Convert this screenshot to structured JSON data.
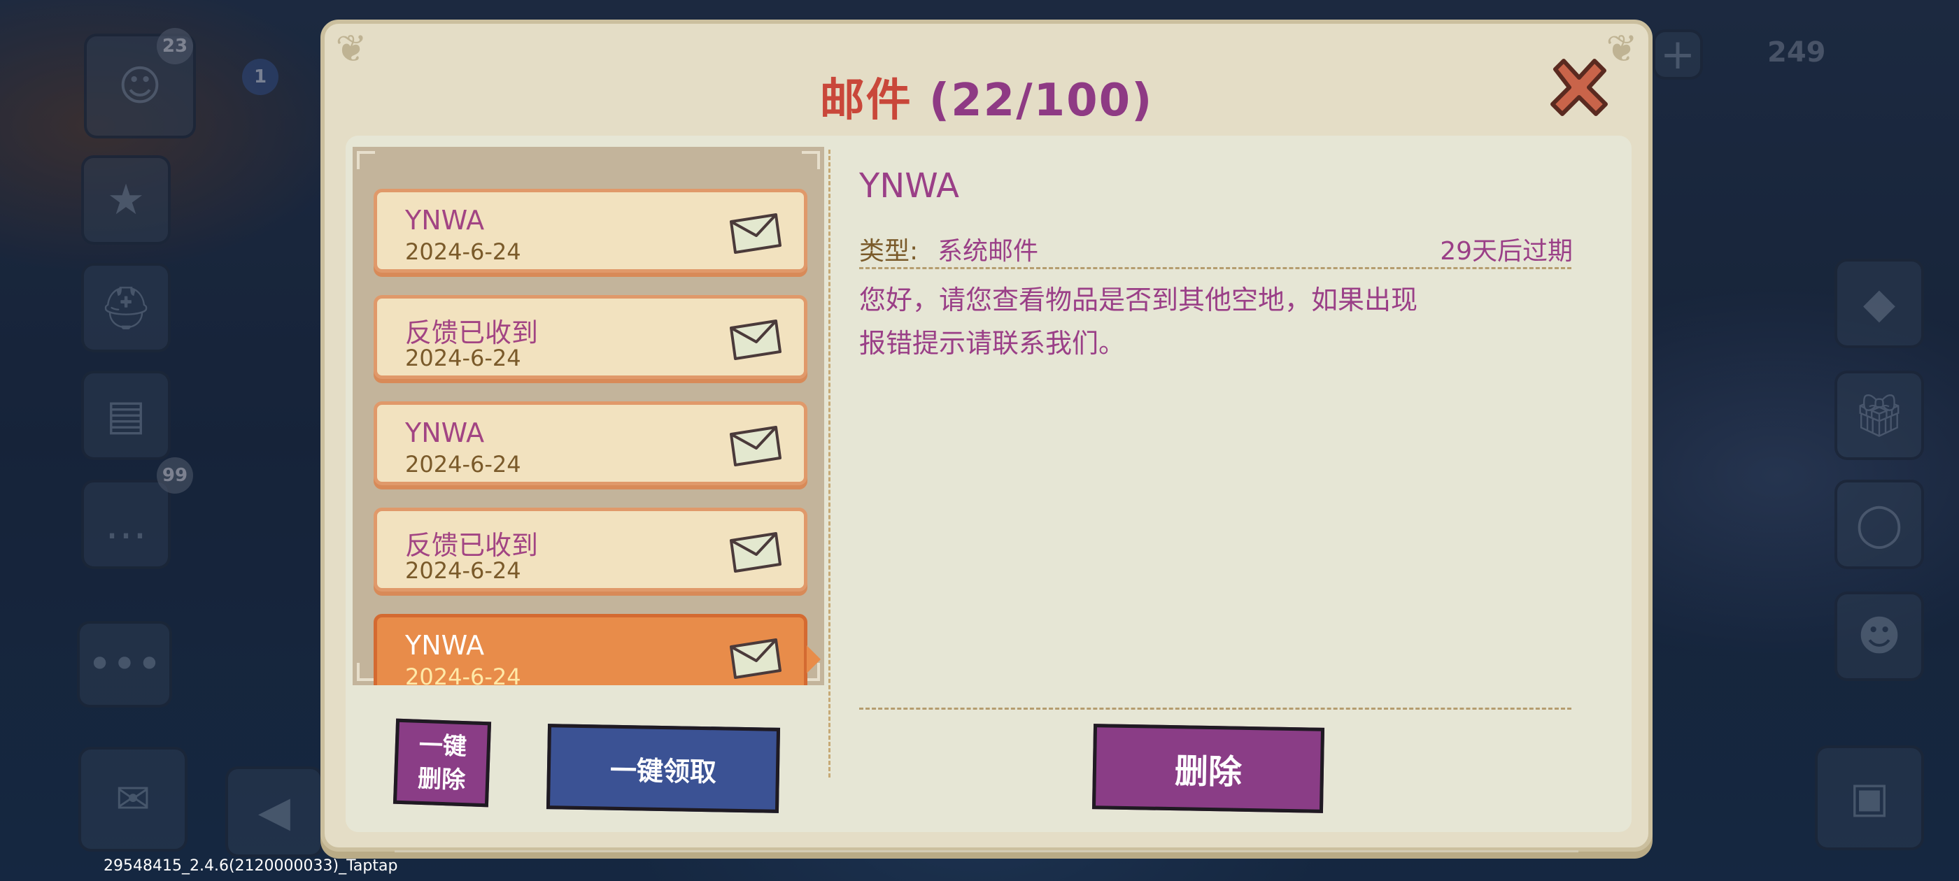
{
  "dialog": {
    "title": "邮件",
    "count": "(22/100)"
  },
  "hud": {
    "avatar_badge": "23",
    "level_badge": "1",
    "chat_badge": "99",
    "currency": "249"
  },
  "mail_list": [
    {
      "name": "YNWA",
      "date": "2024-6-24",
      "selected": false
    },
    {
      "name": "反馈已收到",
      "date": "2024-6-24",
      "selected": false
    },
    {
      "name": "YNWA",
      "date": "2024-6-24",
      "selected": false
    },
    {
      "name": "反馈已收到",
      "date": "2024-6-24",
      "selected": false
    },
    {
      "name": "YNWA",
      "date": "2024-6-24",
      "selected": true
    }
  ],
  "buttons": {
    "onekey_delete_line1": "一键",
    "onekey_delete_line2": "删除",
    "onekey_claim": "一键领取",
    "delete": "删除"
  },
  "detail": {
    "title": "YNWA",
    "type_label": "类型:",
    "type_value": "系统邮件",
    "expire": "29天后过期",
    "body_line1": "您好，请您查看物品是否到其他空地，如果出现",
    "body_line2": "报错提示请联系我们。"
  },
  "footer": {
    "version": "29548415_2.4.6(2120000033)_Taptap"
  },
  "colors": {
    "title_red": "#c9473a",
    "accent_purple": "#8a3d86",
    "accent_blue": "#3b5294",
    "selected_orange": "#e88c4a"
  }
}
